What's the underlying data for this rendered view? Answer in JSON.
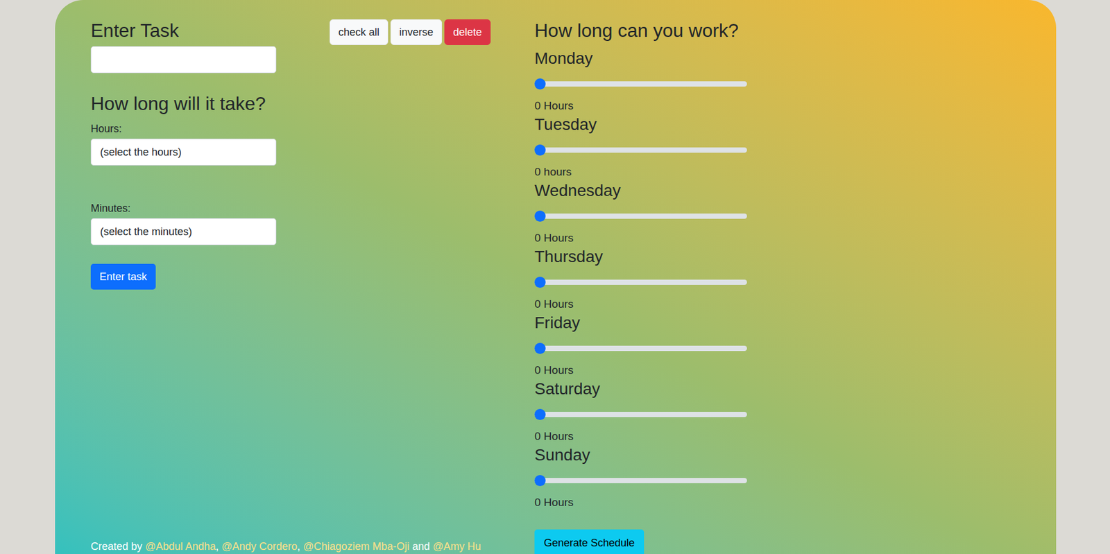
{
  "task_form": {
    "title": "Enter Task",
    "task_input": {
      "value": ""
    },
    "duration_title": "How long will it take?",
    "hours": {
      "label": "Hours:",
      "value": "(select the hours)"
    },
    "minutes": {
      "label": "Minutes:",
      "value": "(select the minutes)"
    },
    "submit": "Enter task"
  },
  "toolbar": [
    {
      "label": "check all",
      "kind": "light"
    },
    {
      "label": "inverse",
      "kind": "light"
    },
    {
      "label": "delete",
      "kind": "danger"
    }
  ],
  "availability": {
    "title": "How long can you work?",
    "days": [
      {
        "name": "Monday",
        "level": 0,
        "reading": "0 Hours"
      },
      {
        "name": "Tuesday",
        "level": 0,
        "reading": "0 hours"
      },
      {
        "name": "Wednesday",
        "level": 0,
        "reading": "0 Hours"
      },
      {
        "name": "Thursday",
        "level": 0,
        "reading": "0 Hours"
      },
      {
        "name": "Friday",
        "level": 0,
        "reading": "0 Hours"
      },
      {
        "name": "Saturday",
        "level": 0,
        "reading": "0 Hours"
      },
      {
        "name": "Sunday",
        "level": 0,
        "reading": "0 Hours"
      }
    ],
    "button": "Generate Schedule"
  },
  "footer": {
    "prefix": "Created by ",
    "authors": [
      "@Abdul Andha",
      "@Andy Cordero",
      "@Chiagoziem Mba-Oji",
      "@Amy Hu"
    ],
    "separators": [
      ", ",
      ", ",
      " and "
    ]
  }
}
